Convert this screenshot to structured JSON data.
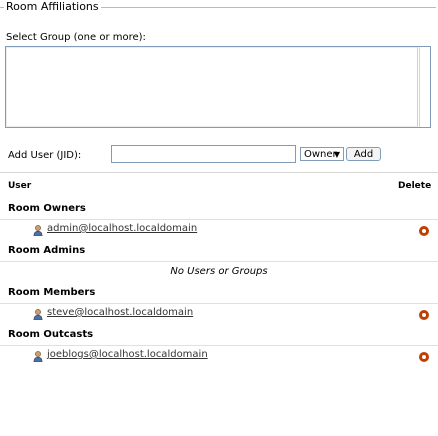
{
  "panel": {
    "legend": "Room Affiliations",
    "select_label": "Select Group (one or more):"
  },
  "add_user": {
    "label": "Add User (JID):",
    "jid_value": "",
    "role_selected": "Owner",
    "add_button": "Add"
  },
  "table": {
    "headers": {
      "user": "User",
      "delete": "Delete"
    },
    "sections": [
      {
        "title": "Room Owners",
        "users": [
          "admin@localhost.localdomain"
        ]
      },
      {
        "title": "Room Admins",
        "users": [],
        "empty_message": "No Users or Groups"
      },
      {
        "title": "Room Members",
        "users": [
          "steve@localhost.localdomain"
        ]
      },
      {
        "title": "Room Outcasts",
        "users": [
          "joeblogs@localhost.localdomain"
        ]
      }
    ]
  },
  "colors": {
    "delete_icon": "#bf3f00",
    "border": "#7f9db9"
  },
  "icons": {
    "user": "person-icon",
    "delete": "delete-icon"
  }
}
